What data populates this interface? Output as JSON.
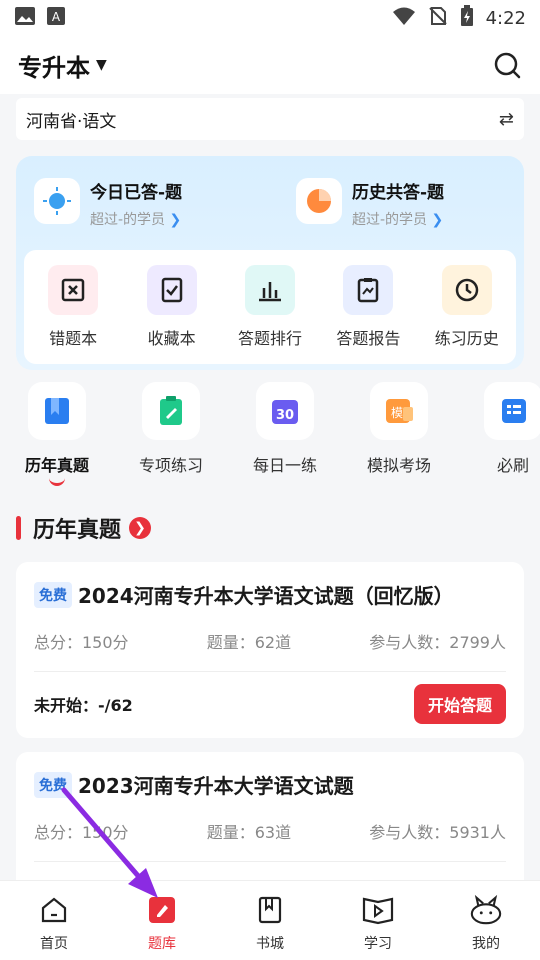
{
  "status_bar": {
    "time": "4:22"
  },
  "header": {
    "title": "专升本"
  },
  "selector": {
    "value": "河南省·语文"
  },
  "stats": [
    {
      "title": "今日已答-题",
      "sub": "超过-的学员"
    },
    {
      "title": "历史共答-题",
      "sub": "超过-的学员"
    }
  ],
  "tools": [
    {
      "label": "错题本"
    },
    {
      "label": "收藏本"
    },
    {
      "label": "答题排行"
    },
    {
      "label": "答题报告"
    },
    {
      "label": "练习历史"
    }
  ],
  "categories": [
    {
      "label": "历年真题"
    },
    {
      "label": "专项练习"
    },
    {
      "label": "每日一练",
      "badge": "30"
    },
    {
      "label": "模拟考场",
      "badge": "模"
    },
    {
      "label": "必刷"
    }
  ],
  "section": {
    "title": "历年真题"
  },
  "papers": [
    {
      "tag": "免费",
      "title": "2024河南专升本大学语文试题（回忆版）",
      "score": "总分：150分",
      "count": "题量：62道",
      "participants": "参与人数：2799人",
      "status": "未开始：-/62",
      "button": "开始答题"
    },
    {
      "tag": "免费",
      "title": "2023河南专升本大学语文试题",
      "score": "总分：150分",
      "count": "题量：63道",
      "participants": "参与人数：5931人"
    }
  ],
  "tabbar": [
    {
      "label": "首页"
    },
    {
      "label": "题库"
    },
    {
      "label": "书城"
    },
    {
      "label": "学习"
    },
    {
      "label": "我的"
    }
  ],
  "colors": {
    "accent": "#e8323c",
    "annotation": "#8b2be2"
  }
}
